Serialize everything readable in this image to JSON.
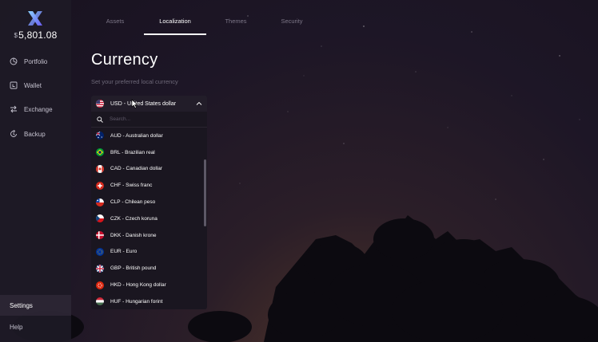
{
  "sidebar": {
    "balance_symbol": "$",
    "balance_value": "5,801.08",
    "items": [
      {
        "label": "Portfolio",
        "icon": "portfolio-icon"
      },
      {
        "label": "Wallet",
        "icon": "wallet-icon"
      },
      {
        "label": "Exchange",
        "icon": "exchange-icon"
      },
      {
        "label": "Backup",
        "icon": "backup-icon"
      }
    ],
    "bottom": [
      {
        "label": "Settings",
        "active": true
      },
      {
        "label": "Help",
        "active": false
      }
    ]
  },
  "tabs": [
    {
      "label": "Assets",
      "active": false
    },
    {
      "label": "Localization",
      "active": true
    },
    {
      "label": "Themes",
      "active": false
    },
    {
      "label": "Security",
      "active": false
    }
  ],
  "main": {
    "title": "Currency",
    "subtitle": "Set your preferred local currency"
  },
  "currency_dropdown": {
    "selected": {
      "label": "USD - United States dollar",
      "flag": "us-flag-icon"
    },
    "search_placeholder": "Search...",
    "options": [
      {
        "label": "AUD - Australian dollar",
        "flag": "au-flag-icon"
      },
      {
        "label": "BRL - Brazilian real",
        "flag": "br-flag-icon"
      },
      {
        "label": "CAD - Canadian dollar",
        "flag": "ca-flag-icon"
      },
      {
        "label": "CHF - Swiss franc",
        "flag": "ch-flag-icon"
      },
      {
        "label": "CLP - Chilean peso",
        "flag": "cl-flag-icon"
      },
      {
        "label": "CZK - Czech koruna",
        "flag": "cz-flag-icon"
      },
      {
        "label": "DKK - Danish krone",
        "flag": "dk-flag-icon"
      },
      {
        "label": "EUR - Euro",
        "flag": "eu-flag-icon"
      },
      {
        "label": "GBP - British pound",
        "flag": "gb-flag-icon"
      },
      {
        "label": "HKD - Hong Kong dollar",
        "flag": "hk-flag-icon"
      },
      {
        "label": "HUF - Hungarian forint",
        "flag": "hu-flag-icon"
      }
    ]
  },
  "colors": {
    "accent": "#5b5bd6",
    "sidebar_bg": "#1e1a26",
    "dropdown_bg": "#1a1620"
  }
}
